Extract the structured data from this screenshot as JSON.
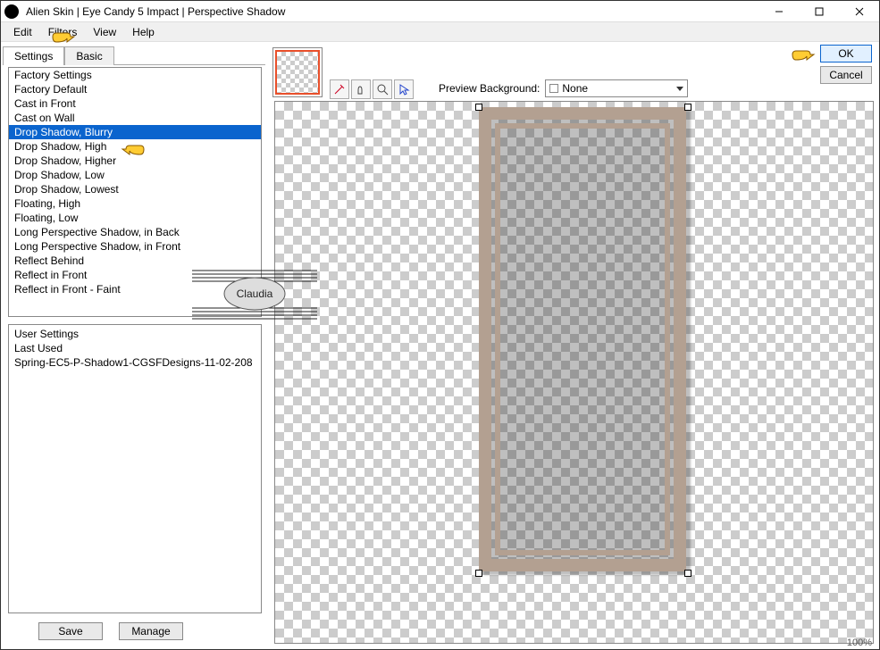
{
  "window": {
    "title": "Alien Skin | Eye Candy 5 Impact | Perspective Shadow"
  },
  "menu": {
    "edit": "Edit",
    "filters": "Filters",
    "view": "View",
    "help": "Help"
  },
  "tabs": {
    "settings": "Settings",
    "basic": "Basic"
  },
  "factory": {
    "header": "Factory Settings",
    "items": [
      "Factory Default",
      "Cast in Front",
      "Cast on Wall",
      "Drop Shadow, Blurry",
      "Drop Shadow, High",
      "Drop Shadow, Higher",
      "Drop Shadow, Low",
      "Drop Shadow, Lowest",
      "Floating, High",
      "Floating, Low",
      "Long Perspective Shadow, in Back",
      "Long Perspective Shadow, in Front",
      "Reflect Behind",
      "Reflect in Front",
      "Reflect in Front - Faint"
    ],
    "selected_index": 3
  },
  "user": {
    "header": "User Settings",
    "items": [
      "Last Used",
      "Spring-EC5-P-Shadow1-CGSFDesigns-11-02-208"
    ]
  },
  "buttons": {
    "save": "Save",
    "manage": "Manage",
    "ok": "OK",
    "cancel": "Cancel"
  },
  "preview_bg": {
    "label": "Preview Background:",
    "value": "None"
  },
  "zoom": "100%",
  "watermark": "Claudia"
}
